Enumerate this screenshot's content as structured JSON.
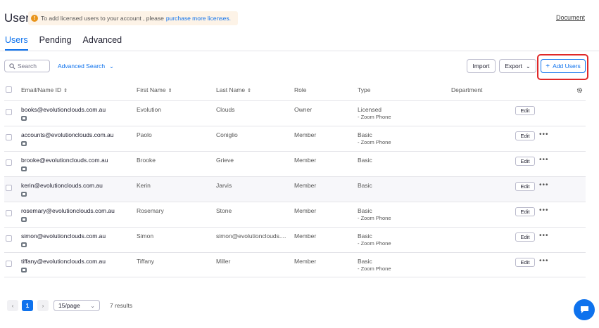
{
  "header": {
    "title": "Users",
    "notice_text": "To add licensed users to your account , please",
    "notice_link": "purchase more licenses.",
    "document_link": "Document"
  },
  "tabs": [
    {
      "label": "Users",
      "active": true
    },
    {
      "label": "Pending",
      "active": false
    },
    {
      "label": "Advanced",
      "active": false
    }
  ],
  "toolbar": {
    "search_placeholder": "Search",
    "advanced_search": "Advanced Search",
    "import_label": "Import",
    "export_label": "Export",
    "add_users_label": "Add Users"
  },
  "table": {
    "columns": {
      "email": "Email/Name ID",
      "first": "First Name",
      "last": "Last Name",
      "role": "Role",
      "type": "Type",
      "department": "Department"
    },
    "edit_label": "Edit",
    "rows": [
      {
        "email": "books@evolutionclouds.com.au",
        "first": "Evolution",
        "last": "Clouds",
        "role": "Owner",
        "type": "Licensed",
        "sub": "- Zoom Phone"
      },
      {
        "email": "accounts@evolutionclouds.com.au",
        "first": "Paolo",
        "last": "Coniglio",
        "role": "Member",
        "type": "Basic",
        "sub": "- Zoom Phone"
      },
      {
        "email": "brooke@evolutionclouds.com.au",
        "first": "Brooke",
        "last": "Grieve",
        "role": "Member",
        "type": "Basic",
        "sub": ""
      },
      {
        "email": "kerin@evolutionclouds.com.au",
        "first": "Kerin",
        "last": "Jarvis",
        "role": "Member",
        "type": "Basic",
        "sub": ""
      },
      {
        "email": "rosemary@evolutionclouds.com.au",
        "first": "Rosemary",
        "last": "Stone",
        "role": "Member",
        "type": "Basic",
        "sub": "- Zoom Phone"
      },
      {
        "email": "simon@evolutionclouds.com.au",
        "first": "Simon",
        "last": "simon@evolutionclouds....",
        "role": "Member",
        "type": "Basic",
        "sub": "- Zoom Phone"
      },
      {
        "email": "tiffany@evolutionclouds.com.au",
        "first": "Tiffany",
        "last": "Miller",
        "role": "Member",
        "type": "Basic",
        "sub": "- Zoom Phone"
      }
    ]
  },
  "pagination": {
    "current_page": "1",
    "page_size": "15/page",
    "results": "7 results"
  },
  "colors": {
    "accent": "#0e72ed",
    "highlight": "#e02828",
    "warning": "#e8941a"
  }
}
